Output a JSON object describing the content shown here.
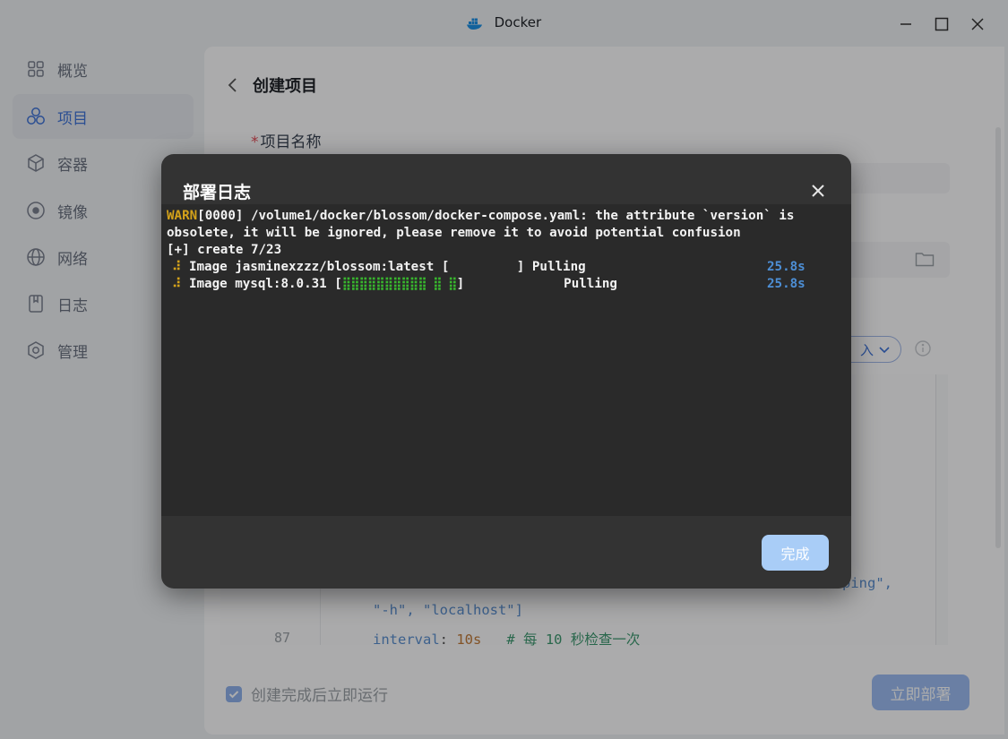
{
  "window": {
    "title": "Docker",
    "accent": "#3f73d8"
  },
  "sidebar": {
    "items": [
      {
        "label": "概览",
        "icon": "grid-icon"
      },
      {
        "label": "项目",
        "icon": "hexagons-icon",
        "active": true
      },
      {
        "label": "容器",
        "icon": "cube-icon"
      },
      {
        "label": "镜像",
        "icon": "disc-icon"
      },
      {
        "label": "网络",
        "icon": "globe-icon"
      },
      {
        "label": "日志",
        "icon": "log-book-icon"
      },
      {
        "label": "管理",
        "icon": "hexagon-gear-icon"
      }
    ]
  },
  "page": {
    "title": "创建项目",
    "name_label": "项目名称",
    "required_mark": "*",
    "import_label": "入",
    "editor": {
      "line_partial": "\"-h\", \"localhost\"]",
      "line_87_num": "87",
      "line_87_key": "interval",
      "line_87_value": "10s",
      "line_87_comment": "# 每 10 秒检查一次",
      "line_86_tail": "ping\","
    },
    "auto_run_label": "创建完成后立即运行",
    "auto_run_checked": true,
    "deploy_button": "立即部署"
  },
  "dialog": {
    "title": "部署日志",
    "log": {
      "line1_warn": "WARN",
      "line1_rest": "[0000] /volume1/docker/blossom/docker-compose.yaml: the attribute `version` is",
      "line2": "obsolete, it will be ignored, please remove it to avoid potential confusion",
      "line3": "[+] create 7/23",
      "images": [
        {
          "spinner": "⠼",
          "prefix": "Image jasminexzzz/blossom:latest [",
          "bar": "          ",
          "suffix": "] Pulling",
          "time": "25.8s"
        },
        {
          "spinner": "⠼",
          "prefix": "Image mysql:8.0.31 [",
          "bar": "⣿⣿⣿⣿⣿⣿⣿⣿⣿⣿ ⣿ ⣿",
          "suffix": "]             Pulling",
          "time": "25.8s"
        }
      ]
    },
    "done_button": "完成"
  }
}
